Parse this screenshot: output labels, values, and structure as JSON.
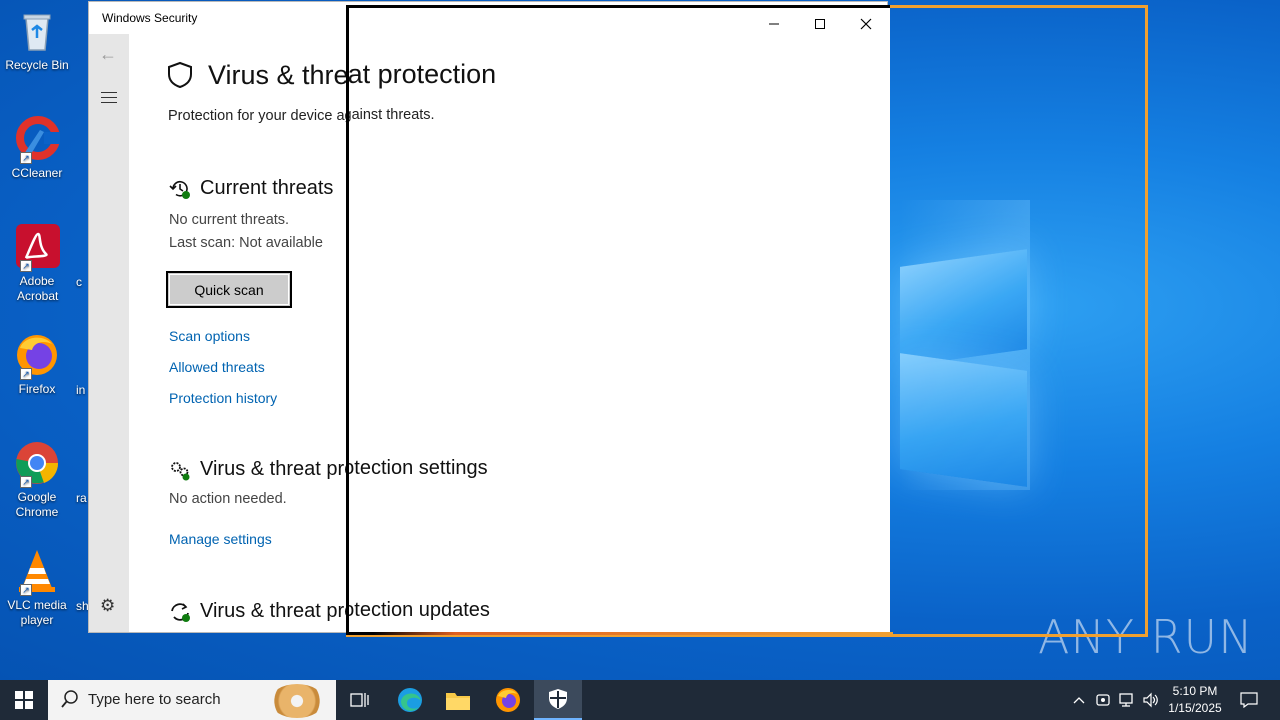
{
  "desktop": {
    "icons": [
      {
        "label": "Recycle Bin",
        "icon": "recycle-bin-icon"
      },
      {
        "label": "CCleaner",
        "icon": "ccleaner-icon"
      },
      {
        "label": "Adobe Acrobat",
        "icon": "adobe-acrobat-icon"
      },
      {
        "label": "Firefox",
        "icon": "firefox-icon"
      },
      {
        "label": "Google Chrome",
        "icon": "chrome-icon"
      },
      {
        "label": "VLC media player",
        "icon": "vlc-icon"
      }
    ],
    "partial_labels": [
      "c",
      "in",
      "ra",
      "sh"
    ],
    "watermark": "ANY RUN"
  },
  "window": {
    "title": "Windows Security",
    "controls": {
      "minimize": "—",
      "maximize": "☐",
      "close": "✕"
    }
  },
  "page": {
    "title": "Virus & threat protection",
    "subtitle": "Protection for your device against threats.",
    "current_threats": {
      "heading": "Current threats",
      "status": "No current threats.",
      "last_scan": "Last scan: Not available",
      "quick_scan_label": "Quick scan",
      "links": [
        "Scan options",
        "Allowed threats",
        "Protection history"
      ]
    },
    "settings": {
      "heading": "Virus & threat protection settings",
      "status": "No action needed.",
      "link": "Manage settings"
    },
    "updates": {
      "heading": "Virus & threat protection updates"
    }
  },
  "taskbar": {
    "search_placeholder": "Type here to search",
    "time": "5:10 PM",
    "date": "1/15/2025"
  },
  "colors": {
    "link": "#0063b1",
    "accent_orange": "#f0a030",
    "taskbar": "#1f2a38"
  }
}
